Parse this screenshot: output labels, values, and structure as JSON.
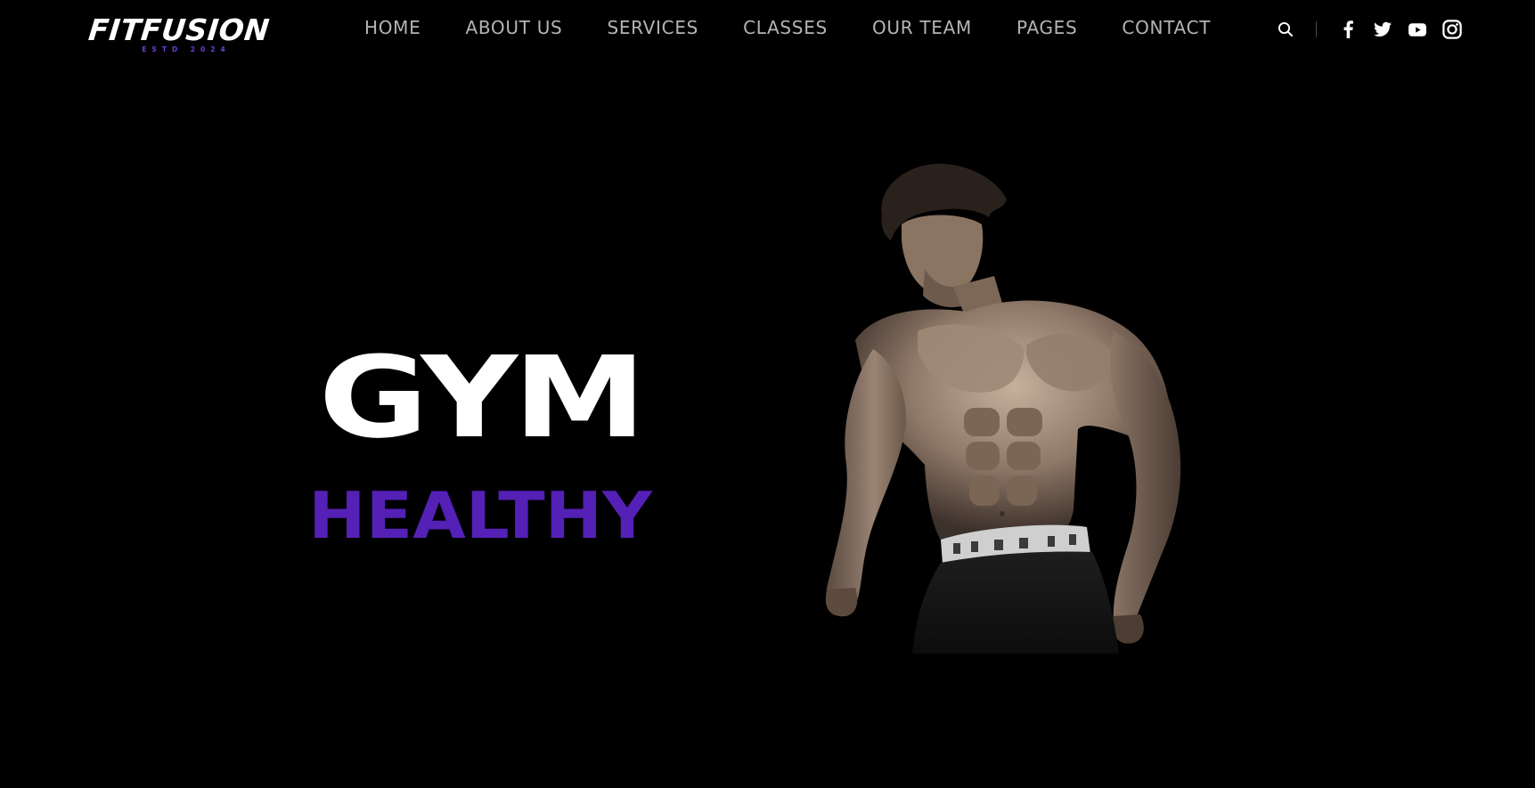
{
  "header": {
    "logo": {
      "wordmark": "FITFUSION",
      "tagline": "ESTD 2024"
    },
    "nav": [
      "HOME",
      "ABOUT US",
      "SERVICES",
      "CLASSES",
      "OUR TEAM",
      "PAGES",
      "CONTACT"
    ],
    "icons": {
      "search": "search-icon",
      "social": [
        "facebook-icon",
        "twitter-icon",
        "youtube-icon",
        "instagram-icon"
      ]
    }
  },
  "hero": {
    "title": "GYM",
    "subtitle": "HEALTHY",
    "image": "muscular-man-photo"
  },
  "colors": {
    "background": "#000000",
    "accent": "#5420b6",
    "nav_text": "#b4b4b4",
    "title_text": "#ffffff"
  }
}
